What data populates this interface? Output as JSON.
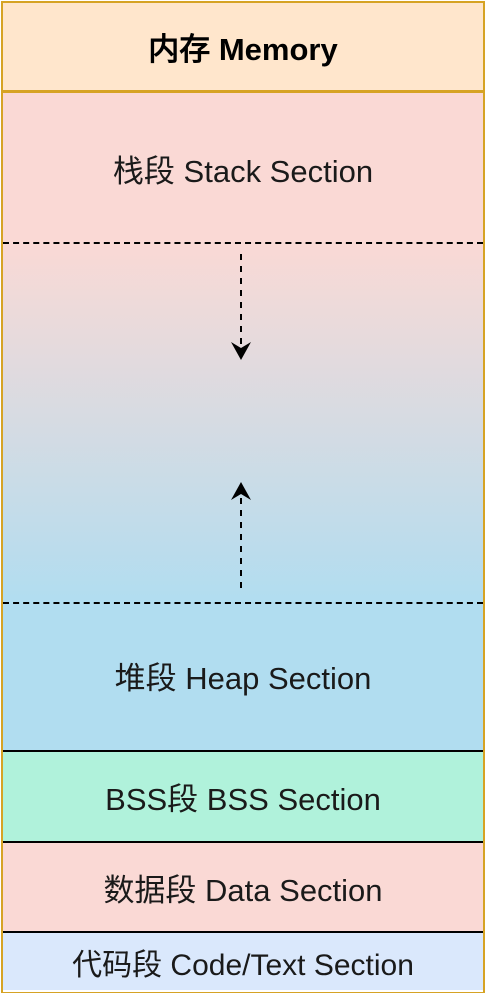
{
  "memory": {
    "title": "内存 Memory",
    "stack": "栈段 Stack Section",
    "heap": "堆段 Heap Section",
    "bss": "BSS段 BSS Section",
    "data": "数据段 Data Section",
    "code": "代码段 Code/Text Section"
  },
  "colors": {
    "border": "#D6A324",
    "header_fill": "#FFE6CC",
    "stack_fill": "#FAD9D5",
    "heap_fill": "#B1DDF0",
    "bss_fill": "#B0F2DB",
    "data_fill": "#FAD9D5",
    "code_fill": "#DAE8FC"
  },
  "arrows": [
    {
      "name": "stack-growth-down-arrow",
      "direction": "down"
    },
    {
      "name": "heap-growth-up-arrow",
      "direction": "up"
    }
  ]
}
